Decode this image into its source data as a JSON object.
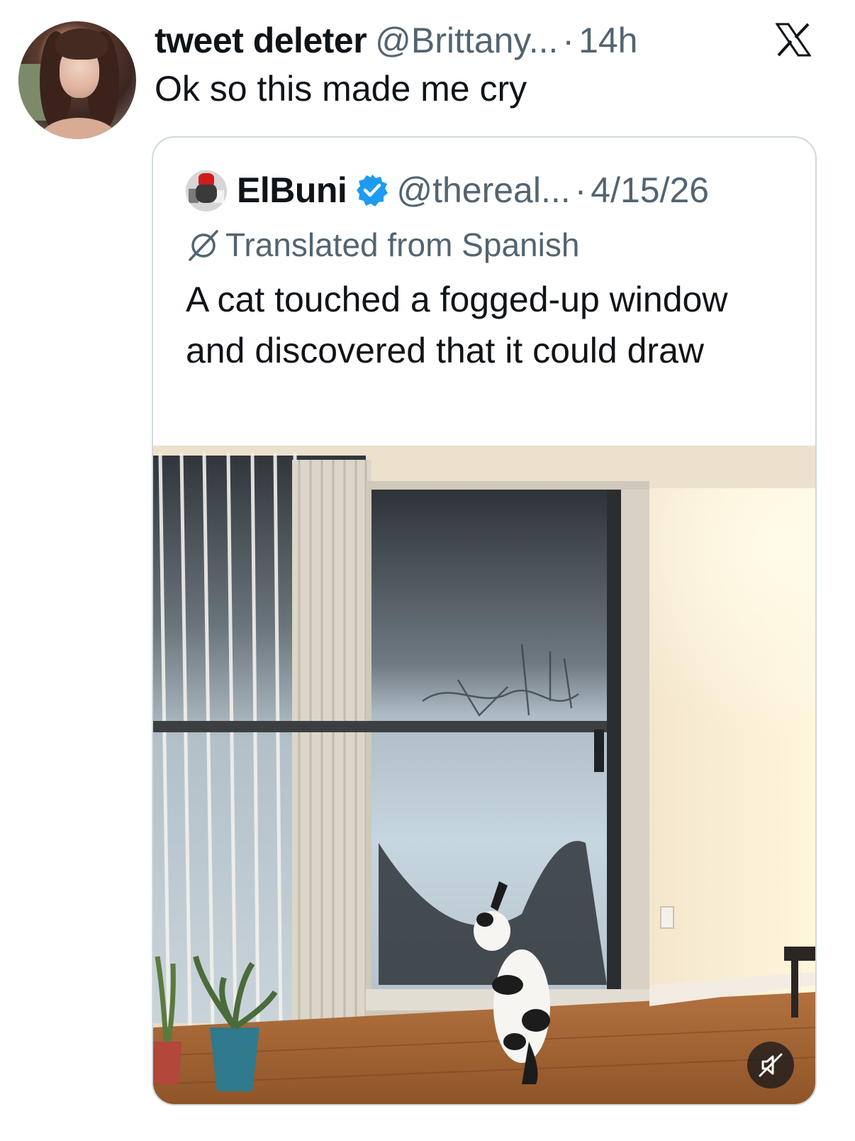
{
  "tweet": {
    "author_name": "tweet deleter",
    "author_handle": "@Brittany...",
    "separator": "·",
    "time": "14h",
    "text": "Ok so this made me cry"
  },
  "app": {
    "logo_icon": "x-logo-icon"
  },
  "quoted_tweet": {
    "author_name": "ElBuni",
    "verified": true,
    "author_handle": "@thereal...",
    "separator": "·",
    "date": "4/15/26",
    "translated_label": "Translated from Spanish",
    "text": "A cat touched a fogged-up window and discovered that it could draw",
    "media": {
      "type": "video",
      "description_icon": "video-thumbnail",
      "muted": true,
      "mute_icon": "speaker-muted-icon"
    }
  },
  "colors": {
    "text_primary": "#0f1419",
    "text_secondary": "#536471",
    "verified_blue": "#1d9bf0",
    "border": "#cfd9de"
  }
}
